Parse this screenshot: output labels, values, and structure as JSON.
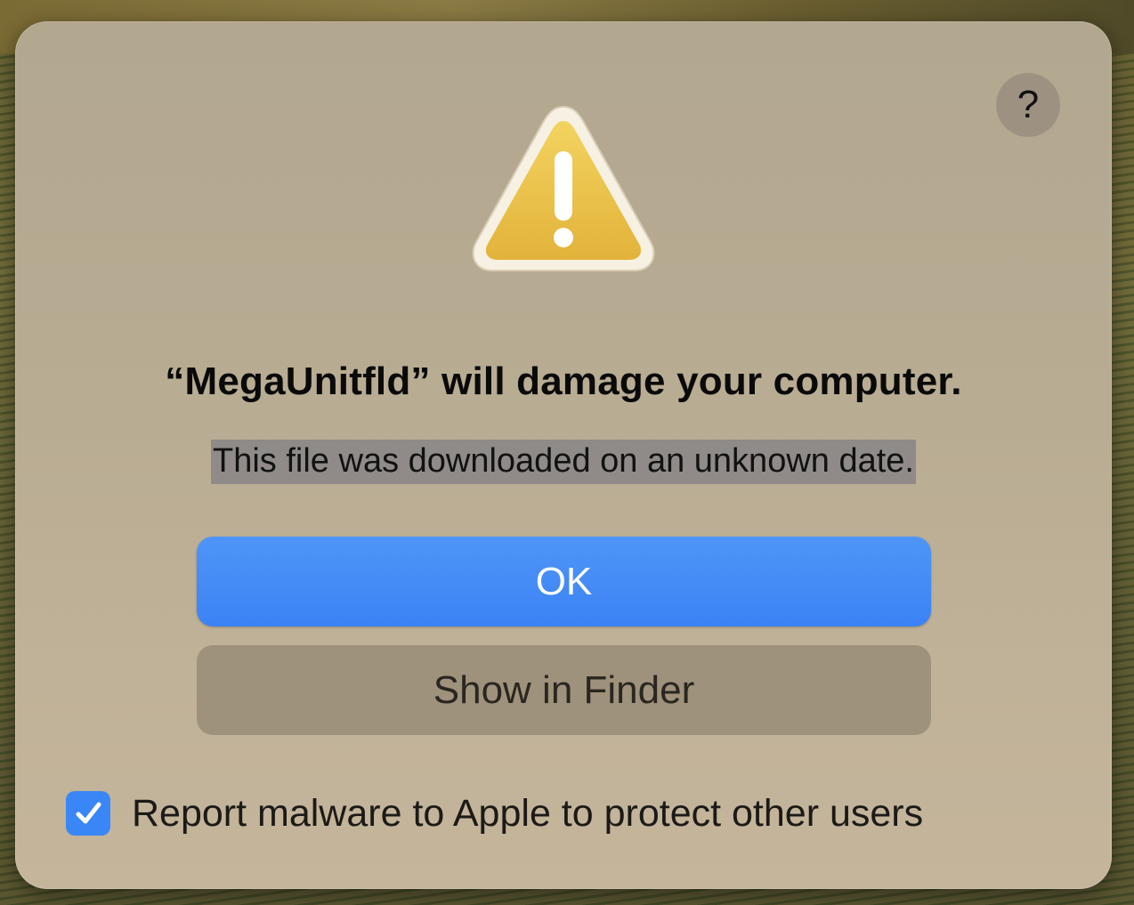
{
  "dialog": {
    "help_label": "?",
    "icon": "warning-triangle-icon",
    "title": "“MegaUnitfld” will damage your computer.",
    "message": "This file was downloaded on an unknown date.",
    "primary_button_label": "OK",
    "secondary_button_label": "Show in Finder",
    "report_checkbox": {
      "label": "Report malware to Apple to protect other users",
      "checked": true
    }
  },
  "colors": {
    "primary_button": "#3b83f5",
    "checkbox": "#3a86f6",
    "warning_fill": "#eec64a",
    "text_selection": "#6e707d"
  }
}
